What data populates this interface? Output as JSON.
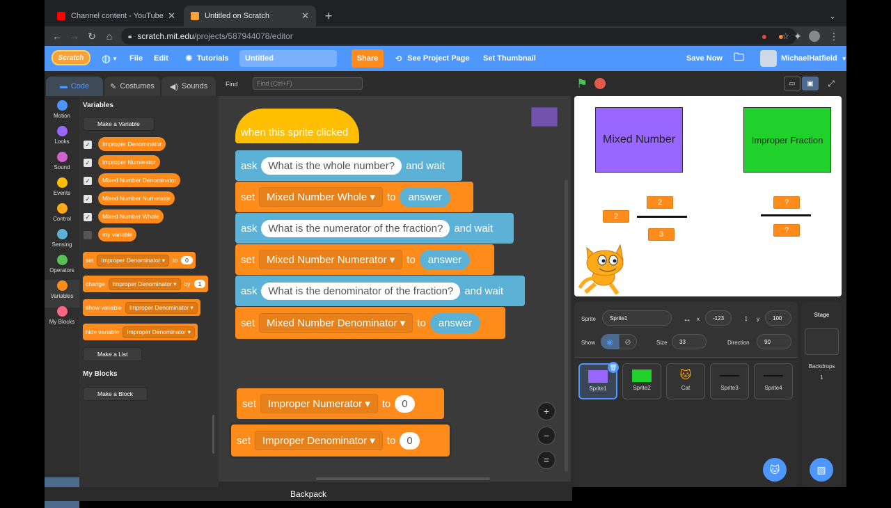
{
  "browser": {
    "tabs": [
      {
        "title": "Channel content - YouTube Stu",
        "active": false,
        "favicon_color": "#ff0000"
      },
      {
        "title": "Untitled on Scratch",
        "active": true,
        "favicon_color": "#f7a13a"
      }
    ],
    "new_tab_label": "+",
    "url_domain": "scratch.mit.edu",
    "url_path": "/projects/587944078/editor"
  },
  "menubar": {
    "logo_text": "Scratch",
    "file": "File",
    "edit": "Edit",
    "tutorials": "Tutorials",
    "project_title": "Untitled",
    "share": "Share",
    "see_project_page": "See Project Page",
    "set_thumbnail": "Set Thumbnail",
    "save_now": "Save Now",
    "username": "MichaelHatfield"
  },
  "editor_tabs": {
    "code": "Code",
    "costumes": "Costumes",
    "sounds": "Sounds"
  },
  "find": {
    "label": "Find",
    "placeholder": "Find (Ctrl+F)"
  },
  "categories": [
    {
      "label": "Motion",
      "color": "#4c97ff"
    },
    {
      "label": "Looks",
      "color": "#9966ff"
    },
    {
      "label": "Sound",
      "color": "#cf63cf"
    },
    {
      "label": "Events",
      "color": "#ffbf00"
    },
    {
      "label": "Control",
      "color": "#ffab19"
    },
    {
      "label": "Sensing",
      "color": "#5cb1d6"
    },
    {
      "label": "Operators",
      "color": "#59c059"
    },
    {
      "label": "Variables",
      "color": "#ff8c1a"
    },
    {
      "label": "My Blocks",
      "color": "#ff6680"
    }
  ],
  "palette": {
    "heading": "Variables",
    "make_variable": "Make a Variable",
    "variables": [
      {
        "name": "Improper Denominator",
        "checked": true
      },
      {
        "name": "Improper Numerator",
        "checked": true
      },
      {
        "name": "Mixed Number Denominator",
        "checked": true
      },
      {
        "name": "Mixed Number Numerator",
        "checked": true
      },
      {
        "name": "Mixed Number Whole",
        "checked": true
      },
      {
        "name": "my variable",
        "checked": false
      }
    ],
    "set_block": {
      "verb": "set",
      "var": "Improper Denominator",
      "to": "to",
      "value": "0"
    },
    "change_block": {
      "verb": "change",
      "var": "Improper Denominator",
      "by": "by",
      "value": "1"
    },
    "show_block": {
      "verb": "show variable",
      "var": "Improper Denominator"
    },
    "hide_block": {
      "verb": "hide variable",
      "var": "Improper Denominator"
    },
    "make_list": "Make a List",
    "myblocks_heading": "My Blocks",
    "make_block": "Make a Block"
  },
  "script": {
    "hat": "when this sprite clicked",
    "blocks": [
      {
        "kind": "ask",
        "verb": "ask",
        "text": "What is the whole number?",
        "tail": "and wait"
      },
      {
        "kind": "set",
        "verb": "set",
        "var": "Mixed Number Whole",
        "to": "to",
        "value": "answer"
      },
      {
        "kind": "ask",
        "verb": "ask",
        "text": "What is the numerator of the fraction?",
        "tail": "and wait"
      },
      {
        "kind": "set",
        "verb": "set",
        "var": "Mixed Number Numerator",
        "to": "to",
        "value": "answer"
      },
      {
        "kind": "ask",
        "verb": "ask",
        "text": "What is the denominator of the fraction?",
        "tail": "and wait"
      },
      {
        "kind": "set",
        "verb": "set",
        "var": "Mixed Number Denominator",
        "to": "to",
        "value": "answer"
      }
    ],
    "loose": [
      {
        "verb": "set",
        "var": "Improper Numerator",
        "to": "to",
        "value": "0"
      },
      {
        "verb": "set",
        "var": "Improper Denominator",
        "to": "to",
        "value": "0"
      }
    ],
    "zoom_in": "+",
    "zoom_out": "−",
    "zoom_reset": "="
  },
  "backpack": "Backpack",
  "stage": {
    "mixed_label": "Mixed Number",
    "improper_label": "Improper Fraction",
    "whole": "2",
    "numerator": "2",
    "denominator": "3",
    "imp_numerator": "?",
    "imp_denominator": "?",
    "mixed_color": "#9966ff",
    "improper_color": "#1fd12a"
  },
  "sprite_info": {
    "sprite_label": "Sprite",
    "sprite_name": "Sprite1",
    "x_label": "x",
    "x": "-123",
    "y_label": "y",
    "y": "100",
    "show_label": "Show",
    "size_label": "Size",
    "size": "33",
    "direction_label": "Direction",
    "direction": "90"
  },
  "sprites": [
    {
      "name": "Sprite1",
      "thumb": "#9966ff",
      "selected": true
    },
    {
      "name": "Sprite2",
      "thumb": "#1fd12a",
      "selected": false
    },
    {
      "name": "Cat",
      "thumb": "#ffab19",
      "selected": false
    },
    {
      "name": "Sprite3",
      "thumb": "#111111",
      "selected": false
    },
    {
      "name": "Sprite4",
      "thumb": "#111111",
      "selected": false
    }
  ],
  "stage_pane": {
    "title": "Stage",
    "backdrops_label": "Backdrops",
    "backdrops_count": "1"
  }
}
